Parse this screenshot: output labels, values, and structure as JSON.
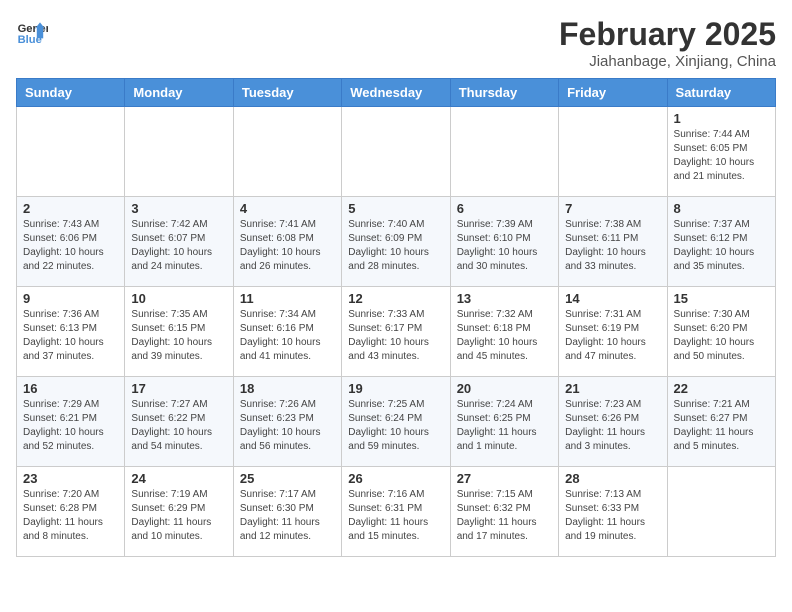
{
  "header": {
    "logo_line1": "General",
    "logo_line2": "Blue",
    "month": "February 2025",
    "location": "Jiahanbage, Xinjiang, China"
  },
  "weekdays": [
    "Sunday",
    "Monday",
    "Tuesday",
    "Wednesday",
    "Thursday",
    "Friday",
    "Saturday"
  ],
  "weeks": [
    [
      {
        "day": "",
        "info": ""
      },
      {
        "day": "",
        "info": ""
      },
      {
        "day": "",
        "info": ""
      },
      {
        "day": "",
        "info": ""
      },
      {
        "day": "",
        "info": ""
      },
      {
        "day": "",
        "info": ""
      },
      {
        "day": "1",
        "info": "Sunrise: 7:44 AM\nSunset: 6:05 PM\nDaylight: 10 hours\nand 21 minutes."
      }
    ],
    [
      {
        "day": "2",
        "info": "Sunrise: 7:43 AM\nSunset: 6:06 PM\nDaylight: 10 hours\nand 22 minutes."
      },
      {
        "day": "3",
        "info": "Sunrise: 7:42 AM\nSunset: 6:07 PM\nDaylight: 10 hours\nand 24 minutes."
      },
      {
        "day": "4",
        "info": "Sunrise: 7:41 AM\nSunset: 6:08 PM\nDaylight: 10 hours\nand 26 minutes."
      },
      {
        "day": "5",
        "info": "Sunrise: 7:40 AM\nSunset: 6:09 PM\nDaylight: 10 hours\nand 28 minutes."
      },
      {
        "day": "6",
        "info": "Sunrise: 7:39 AM\nSunset: 6:10 PM\nDaylight: 10 hours\nand 30 minutes."
      },
      {
        "day": "7",
        "info": "Sunrise: 7:38 AM\nSunset: 6:11 PM\nDaylight: 10 hours\nand 33 minutes."
      },
      {
        "day": "8",
        "info": "Sunrise: 7:37 AM\nSunset: 6:12 PM\nDaylight: 10 hours\nand 35 minutes."
      }
    ],
    [
      {
        "day": "9",
        "info": "Sunrise: 7:36 AM\nSunset: 6:13 PM\nDaylight: 10 hours\nand 37 minutes."
      },
      {
        "day": "10",
        "info": "Sunrise: 7:35 AM\nSunset: 6:15 PM\nDaylight: 10 hours\nand 39 minutes."
      },
      {
        "day": "11",
        "info": "Sunrise: 7:34 AM\nSunset: 6:16 PM\nDaylight: 10 hours\nand 41 minutes."
      },
      {
        "day": "12",
        "info": "Sunrise: 7:33 AM\nSunset: 6:17 PM\nDaylight: 10 hours\nand 43 minutes."
      },
      {
        "day": "13",
        "info": "Sunrise: 7:32 AM\nSunset: 6:18 PM\nDaylight: 10 hours\nand 45 minutes."
      },
      {
        "day": "14",
        "info": "Sunrise: 7:31 AM\nSunset: 6:19 PM\nDaylight: 10 hours\nand 47 minutes."
      },
      {
        "day": "15",
        "info": "Sunrise: 7:30 AM\nSunset: 6:20 PM\nDaylight: 10 hours\nand 50 minutes."
      }
    ],
    [
      {
        "day": "16",
        "info": "Sunrise: 7:29 AM\nSunset: 6:21 PM\nDaylight: 10 hours\nand 52 minutes."
      },
      {
        "day": "17",
        "info": "Sunrise: 7:27 AM\nSunset: 6:22 PM\nDaylight: 10 hours\nand 54 minutes."
      },
      {
        "day": "18",
        "info": "Sunrise: 7:26 AM\nSunset: 6:23 PM\nDaylight: 10 hours\nand 56 minutes."
      },
      {
        "day": "19",
        "info": "Sunrise: 7:25 AM\nSunset: 6:24 PM\nDaylight: 10 hours\nand 59 minutes."
      },
      {
        "day": "20",
        "info": "Sunrise: 7:24 AM\nSunset: 6:25 PM\nDaylight: 11 hours\nand 1 minute."
      },
      {
        "day": "21",
        "info": "Sunrise: 7:23 AM\nSunset: 6:26 PM\nDaylight: 11 hours\nand 3 minutes."
      },
      {
        "day": "22",
        "info": "Sunrise: 7:21 AM\nSunset: 6:27 PM\nDaylight: 11 hours\nand 5 minutes."
      }
    ],
    [
      {
        "day": "23",
        "info": "Sunrise: 7:20 AM\nSunset: 6:28 PM\nDaylight: 11 hours\nand 8 minutes."
      },
      {
        "day": "24",
        "info": "Sunrise: 7:19 AM\nSunset: 6:29 PM\nDaylight: 11 hours\nand 10 minutes."
      },
      {
        "day": "25",
        "info": "Sunrise: 7:17 AM\nSunset: 6:30 PM\nDaylight: 11 hours\nand 12 minutes."
      },
      {
        "day": "26",
        "info": "Sunrise: 7:16 AM\nSunset: 6:31 PM\nDaylight: 11 hours\nand 15 minutes."
      },
      {
        "day": "27",
        "info": "Sunrise: 7:15 AM\nSunset: 6:32 PM\nDaylight: 11 hours\nand 17 minutes."
      },
      {
        "day": "28",
        "info": "Sunrise: 7:13 AM\nSunset: 6:33 PM\nDaylight: 11 hours\nand 19 minutes."
      },
      {
        "day": "",
        "info": ""
      }
    ]
  ]
}
